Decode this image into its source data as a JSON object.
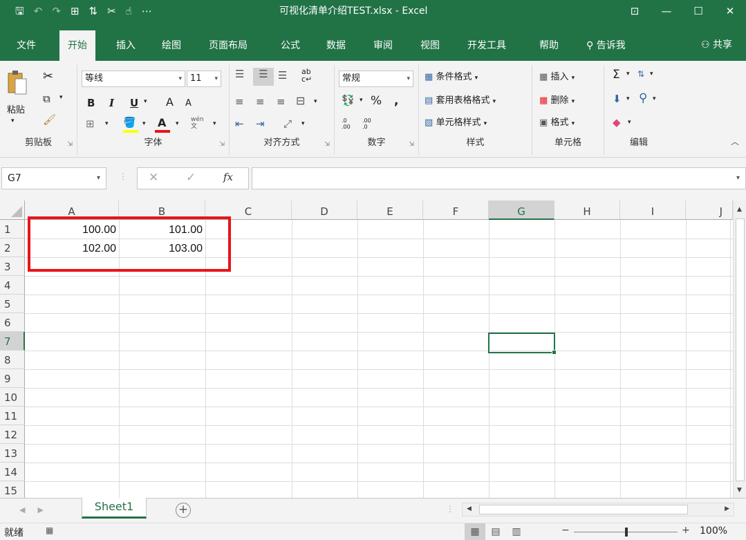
{
  "window": {
    "title": "可视化清单介绍TEST.xlsx  -  Excel",
    "controls": {
      "ribbon_display": "⊡",
      "minimize": "—",
      "maximize": "☐",
      "close": "✕"
    }
  },
  "qat": {
    "save": "🖫",
    "undo": "↶",
    "redo": "↷",
    "form": "⊞",
    "sort": "⇅",
    "tool": "✂",
    "touch": "☝",
    "more": "⋯"
  },
  "tabs": {
    "items": [
      "文件",
      "开始",
      "插入",
      "绘图",
      "页面布局",
      "公式",
      "数据",
      "审阅",
      "视图",
      "开发工具",
      "帮助"
    ],
    "active": "开始",
    "tell_me": "告诉我",
    "share": "共享"
  },
  "ribbon": {
    "clipboard": {
      "paste": "粘贴",
      "label": "剪贴板"
    },
    "font": {
      "name": "等线",
      "size": "11",
      "bold": "B",
      "italic": "I",
      "underline": "U",
      "grow": "A",
      "shrink": "A",
      "fill_color": "#ffff00",
      "font_color": "#e8141b",
      "label": "字体",
      "wen": "wén"
    },
    "alignment": {
      "label": "对齐方式"
    },
    "number": {
      "format": "常规",
      "percent": "%",
      "comma": ",",
      "dec_inc": ".0 .00",
      "dec_dec": ".00 .0",
      "label": "数字"
    },
    "styles": {
      "conditional": "条件格式",
      "table": "套用表格格式",
      "cell": "单元格样式",
      "label": "样式"
    },
    "cells": {
      "insert": "插入",
      "delete": "删除",
      "format": "格式",
      "label": "单元格"
    },
    "editing": {
      "sum": "Σ",
      "label": "编辑"
    }
  },
  "formula_bar": {
    "name_box": "G7",
    "cancel": "✕",
    "enter": "✓",
    "fx": "fx",
    "value": ""
  },
  "grid": {
    "columns": [
      "A",
      "B",
      "C",
      "D",
      "E",
      "F",
      "G",
      "H",
      "I",
      "J"
    ],
    "rows": [
      "1",
      "2",
      "3",
      "4",
      "5",
      "6",
      "7",
      "8",
      "9",
      "10",
      "11",
      "12",
      "13",
      "14",
      "15"
    ],
    "selected_column": "G",
    "selected_row": "7",
    "cells": {
      "A1": "100.00",
      "B1": "101.00",
      "A2": "102.00",
      "B2": "103.00"
    }
  },
  "sheets": {
    "tabs": [
      "Sheet1"
    ],
    "active": "Sheet1"
  },
  "status": {
    "ready": "就绪",
    "zoom": "100%"
  },
  "colors": {
    "accent": "#217346",
    "highlight": "#e8141b"
  }
}
